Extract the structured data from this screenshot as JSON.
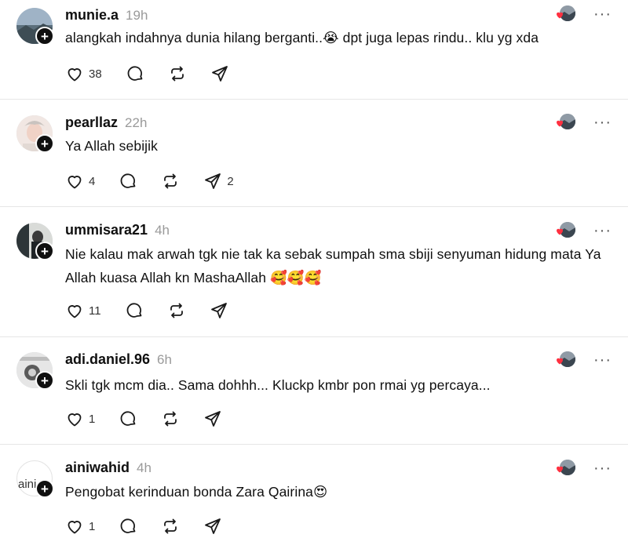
{
  "posts": [
    {
      "username": "munie.a",
      "time": "19h",
      "text": "alangkah indahnya dunia hilang berganti..😭 dpt juga lepas rindu.. klu yg xda",
      "likes": "38",
      "replies": "",
      "reposts": "",
      "shares": ""
    },
    {
      "username": "pearllaz",
      "time": "22h",
      "text": "Ya Allah sebijik",
      "likes": "4",
      "replies": "",
      "reposts": "",
      "shares": "2"
    },
    {
      "username": "ummisara21",
      "time": "4h",
      "text": "Nie kalau mak arwah tgk nie tak ka sebak sumpah sma sbiji senyuman hidung mata Ya Allah kuasa Allah kn MashaAllah 🥰🥰🥰",
      "likes": "11",
      "replies": "",
      "reposts": "",
      "shares": ""
    },
    {
      "username": "adi.daniel.96",
      "time": "6h",
      "text": "Skli tgk mcm dia.. Sama dohhh... Kluckp kmbr pon rmai yg percaya...",
      "likes": "1",
      "replies": "",
      "reposts": "",
      "shares": ""
    },
    {
      "username": "ainiwahid",
      "time": "4h",
      "text": "Pengobat kerinduan bonda Zara Qairina😍",
      "likes": "1",
      "replies": "",
      "reposts": "",
      "shares": ""
    }
  ],
  "avatar_fallback_text": "aini",
  "icons": {
    "follow": "plus-icon",
    "liked_by_author": "heart-with-author-avatar-icon",
    "more": "more-dots-icon",
    "like": "heart-outline-icon",
    "reply": "comment-bubble-icon",
    "repost": "repost-arrows-icon",
    "share": "send-paper-plane-icon"
  },
  "colors": {
    "text": "#101010",
    "muted": "#9a9a9a",
    "heart_red": "#ff3040",
    "divider": "#e6e6e6"
  }
}
